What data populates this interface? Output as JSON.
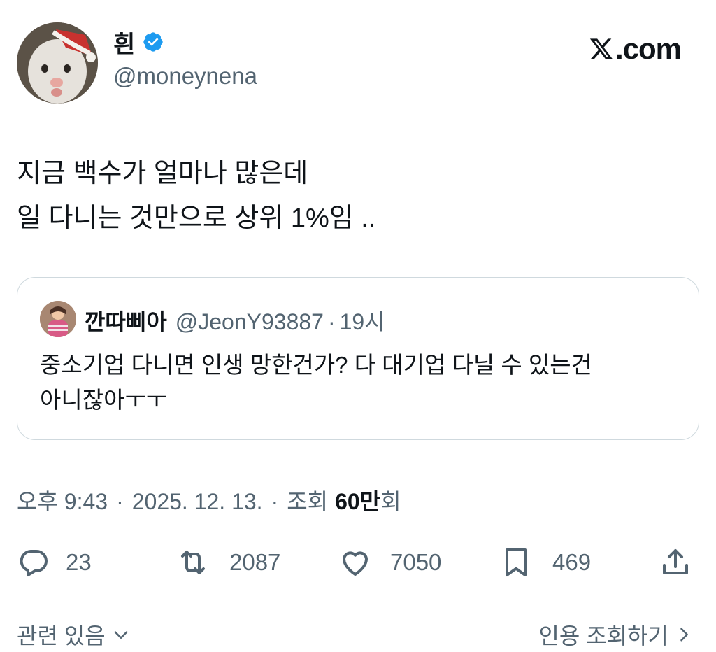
{
  "author": {
    "display_name": "흰",
    "handle": "@moneynena",
    "verified": true,
    "avatar_icon": "cat-with-santa-hat-avatar"
  },
  "branding": {
    "site": "X.com",
    "logo_icon": "x-logo-icon"
  },
  "tweet": {
    "lines": [
      "지금 백수가 얼마나 많은데",
      "일 다니는 것만으로 상위 1%임 .."
    ]
  },
  "quoted_tweet": {
    "display_name": "깐따삐아",
    "handle": "@JeonY93887",
    "separator": "·",
    "time": "19시",
    "avatar_icon": "person-avatar",
    "lines": [
      "중소기업 다니면 인생 망한건가? 다 대기업 다닐 수 있는건",
      "아니잖아ㅜㅜ"
    ]
  },
  "meta": {
    "time": "오후 9:43",
    "date": "2025. 12. 13.",
    "views_label": "조회",
    "views_number": "60만",
    "views_suffix": "회",
    "separator": "·"
  },
  "actions": {
    "replies": "23",
    "retweets": "2087",
    "likes": "7050",
    "bookmarks": "469"
  },
  "footer": {
    "related": "관련 있음",
    "quotes": "인용 조회하기"
  },
  "colors": {
    "text_primary": "#0f1419",
    "text_secondary": "#536471",
    "border": "#cfd9de",
    "verified_blue": "#1d9bf0"
  }
}
